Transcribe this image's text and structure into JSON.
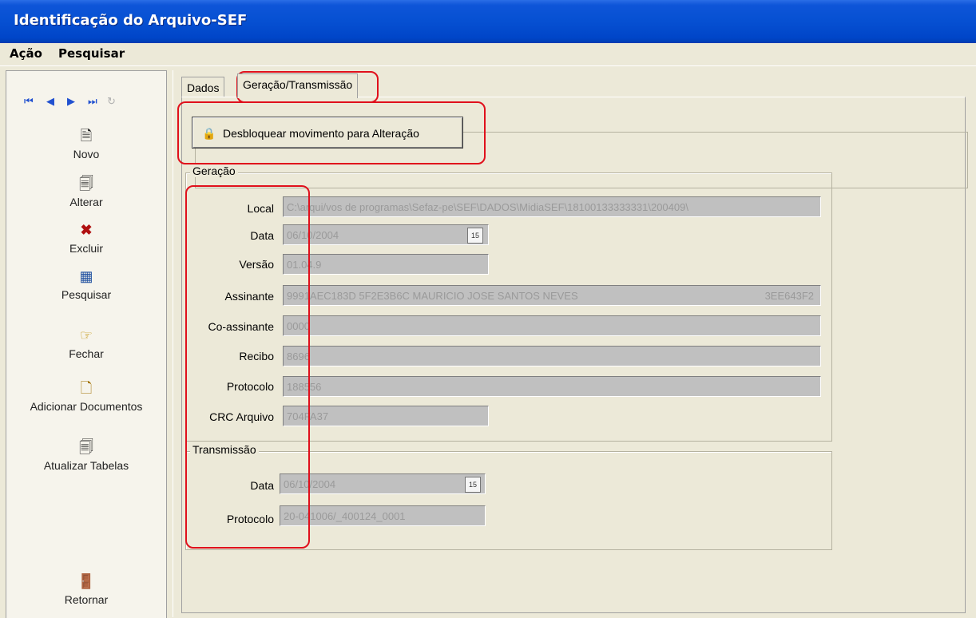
{
  "window": {
    "title": "Identificação do Arquivo-SEF"
  },
  "menu": [
    "Ação",
    "Pesquisar"
  ],
  "toolbar": {
    "novo": "Novo",
    "alterar": "Alterar",
    "excluir": "Excluir",
    "pesquisar": "Pesquisar",
    "fechar": "Fechar",
    "adicionar_documentos": "Adicionar Documentos",
    "atualizar_tabelas": "Atualizar Tabelas",
    "retornar": "Retornar"
  },
  "tabs": [
    "Dados",
    "Geração/Transmissão"
  ],
  "unlock_button": "Desbloquear movimento para Alteração",
  "geracao": {
    "title": "Geração",
    "local_label": "Local",
    "local_value": "C:\\arqui/vos de programas\\Sefaz-pe\\SEF\\DADOS\\MidiaSEF\\18100133333331\\200409\\",
    "data_label": "Data",
    "data_value": "06/10/2004",
    "versao_label": "Versão",
    "versao_value": "01.04.9",
    "assinante_label": "Assinante",
    "assinante_value": "9991AEC183D  5F2E3B6C  MAURICIO JOSE SANTOS NEVES",
    "assinante_code": "3EE643F2",
    "coassinante_label": "Co-assinante",
    "coassinante_value": "0000",
    "recibo_label": "Recibo",
    "recibo_value": "8696",
    "protocolo_label": "Protocolo",
    "protocolo_value": "188556",
    "crc_label": "CRC Arquivo",
    "crc_value": "704FA37"
  },
  "transmissao": {
    "title": "Transmissão",
    "data_label": "Data",
    "data_value": "06/10/2004",
    "protocolo_label": "Protocolo",
    "protocolo_value": "20-041006/_400124_0001"
  },
  "colors": {
    "title_blue": "#0650d2",
    "annotation_red": "#e0101c",
    "face": "#ece9d8"
  }
}
